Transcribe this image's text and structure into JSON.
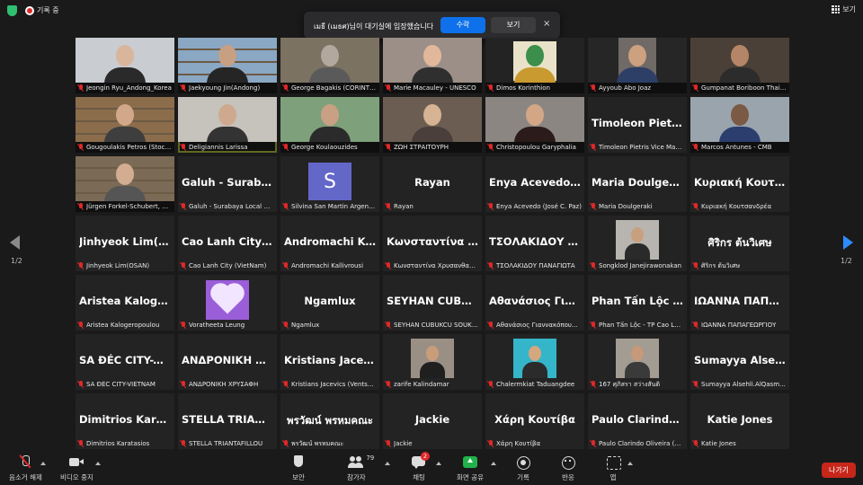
{
  "topbar": {
    "recording": "기록 중",
    "view": "보기"
  },
  "notification": {
    "message": "เมธี (เมธศ)님이 대기실에 입장했습니다",
    "admit": "수락",
    "view": "보기",
    "close": "×"
  },
  "pagination": {
    "left": "1/2",
    "right": "1/2"
  },
  "tiles": [
    {
      "name": "",
      "label": "Jeongin Ryu_Andong_Korea",
      "video": true,
      "bg": "#c9cdd2",
      "head": "#d9b59c",
      "body": "#2a2a2a"
    },
    {
      "name": "",
      "label": "Jaekyoung Jin(Andong)",
      "video": true,
      "bg": "#8aa7c3",
      "head": "#c79f82",
      "body": "#252525",
      "shelves": true
    },
    {
      "name": "",
      "label": "George Bagakis (CORINTH_GR)",
      "video": true,
      "bg": "#7c7262",
      "head": "#b2a89d",
      "body": "#5a5a5a"
    },
    {
      "name": "",
      "label": "Marie Macauley - UNESCO",
      "video": true,
      "bg": "#9b8f88",
      "head": "#e2b89c",
      "body": "#2f2f2f"
    },
    {
      "name": "",
      "label": "Dimos Korinthion",
      "video": true,
      "bg": "#232323",
      "head": "#3b8f4a",
      "body": "#c89a2f",
      "logo": true
    },
    {
      "name": "",
      "label": "Ayyoub Abo Joaz",
      "video": true,
      "bg": "#262626",
      "head": "#cda07f",
      "body": "#2d3f66",
      "small": true
    },
    {
      "name": "",
      "label": "Gumpanat Boriboon Thailand",
      "video": true,
      "bg": "#4a4038",
      "head": "#b48667",
      "body": "#2c2c2c"
    },
    {
      "name": "",
      "label": "Gougoulakis Petros (Stockholm)",
      "video": true,
      "bg": "#8b6d4c",
      "head": "#d1a88a",
      "body": "#3e3e3e",
      "shelves": true
    },
    {
      "name": "",
      "label": "Deligiannis Larissa",
      "video": true,
      "bg": "#c6c2bc",
      "head": "#cfa98f",
      "body": "#333333",
      "active": true
    },
    {
      "name": "",
      "label": "George Koulaouzides",
      "video": true,
      "bg": "#7ea07a",
      "head": "#c9a083",
      "body": "#2b2b2b"
    },
    {
      "name": "",
      "label": "ΖΩΗ ΣΤΡΑΙΤΟΥΡΗ",
      "video": true,
      "bg": "#6b5d52",
      "head": "#d6b393",
      "body": "#4a3f3a"
    },
    {
      "name": "",
      "label": "Christopoulou Garyphalia",
      "video": true,
      "bg": "#8b8682",
      "head": "#d3a686",
      "body": "#2b1b1b"
    },
    {
      "name": "Timoleon Pietri...",
      "label": "Timoleon Pietris Vice Mayor",
      "video": false
    },
    {
      "name": "",
      "label": "Marcos Antunes - CMB",
      "video": true,
      "bg": "#9aa4ad",
      "head": "#7a5a45",
      "body": "#2c3e6e"
    },
    {
      "name": "",
      "label": "Jürgen Forkel-Schubert, Hamburg",
      "video": true,
      "bg": "#7b6a55",
      "head": "#d2ad91",
      "body": "#555555",
      "shelves": true
    },
    {
      "name": "Galuh - Surabay...",
      "label": "Galuh - Surabaya Local Gover...",
      "video": false
    },
    {
      "name": "",
      "label": "Silvina San Martin Argentina",
      "video": false,
      "avatar": "S"
    },
    {
      "name": "Rayan",
      "label": "Rayan",
      "video": false
    },
    {
      "name": "Enya Acevedo (J...",
      "label": "Enya Acevedo (José C. Paz)",
      "video": false
    },
    {
      "name": "Maria Doulgeraki",
      "label": "Maria Doulgeraki",
      "video": false
    },
    {
      "name": "Κυριακή Κουτσ...",
      "label": "Κυριακή Κουτσανδρέα",
      "video": false
    },
    {
      "name": "Jinhyeok Lim(O...",
      "label": "Jinhyeok Lim(OSAN)",
      "video": false
    },
    {
      "name": "Cao Lanh City (...",
      "label": "Cao Lanh City (VietNam)",
      "video": false
    },
    {
      "name": "Andromachi Kal...",
      "label": "Andromachi Kallivrousi",
      "video": false
    },
    {
      "name": "Κωνσταντίνα Χ...",
      "label": "Κωνσταντίνα Χρυσανθακοπούλου",
      "video": false
    },
    {
      "name": "ΤΣΟΛΑΚΙΔΟΥ Π...",
      "label": "ΤΣΟΛΑΚΙΔΟΥ ΠΑΝΑΓΙΩΤΑ",
      "video": false
    },
    {
      "name": "",
      "label": "Songklod Janejirawonakan",
      "video": false,
      "photo": true,
      "photoBg": "#b8b5b0",
      "photoHead": "#c9a07e",
      "photoBody": "#2a2a2a"
    },
    {
      "name": "ศิริกร ต้นวิเศษ",
      "label": "ศิริกร ต้นวิเศษ",
      "video": false
    },
    {
      "name": "Aristea Kaloger...",
      "label": "Aristea Kalogeropoulou",
      "video": false
    },
    {
      "name": "",
      "label": "Voratheeta Leung",
      "video": false,
      "heart": true
    },
    {
      "name": "Ngamlux",
      "label": "Ngamlux",
      "video": false
    },
    {
      "name": "SEYHAN CUBUK...",
      "label": "SEYHAN CUBUKCU SOUKE...",
      "video": false
    },
    {
      "name": "Αθανάσιος Γιαν...",
      "label": "Αθανάσιος Γιαννακόπουλος",
      "video": false
    },
    {
      "name": "Phan Tấn Lộc -...",
      "label": "Phan Tấn Lộc - TP Cao Lãnh",
      "video": false
    },
    {
      "name": "ΙΩΑΝΝΑ ΠΑΠΑ...",
      "label": "ΙΩΑΝΝΑ ΠΑΠΑΓΕΩΡΓΙΟΥ",
      "video": false
    },
    {
      "name": "SA ĐÉC CITY-VI...",
      "label": "SA ĐÉC CITY-VIETNAM",
      "video": false
    },
    {
      "name": "ΑΝΔΡΟΝΙΚΗ Χ...",
      "label": "ΑΝΔΡΟΝΙΚΗ ΧΡΥΣΑΦΗ",
      "video": false
    },
    {
      "name": "Kristians Jacevic...",
      "label": "Kristians Jacevics (Ventspils)",
      "video": false
    },
    {
      "name": "",
      "label": "zarife Kalindamar",
      "video": false,
      "photo": true,
      "photoBg": "#9a8f85",
      "photoHead": "#c99c7a",
      "photoBody": "#1f1f1f"
    },
    {
      "name": "",
      "label": "Chalermkiat Taduangdee",
      "video": false,
      "photo": true,
      "photoBg": "#35b5c9",
      "photoHead": "#d4a77f",
      "photoBody": "#2b2b2b"
    },
    {
      "name": "",
      "label": "167 ศุภิสรา สว่างสันติ",
      "video": false,
      "photo": true,
      "photoBg": "#a39c92",
      "photoHead": "#c5997a",
      "photoBody": "#3a3a3a"
    },
    {
      "name": "Sumayya Alseh...",
      "label": "Sumayya Alsehli.AlQasm...",
      "video": false
    },
    {
      "name": "Dimitrios Karat...",
      "label": "Dimitrios Karatasios",
      "video": false
    },
    {
      "name": "STELLA TRIANT...",
      "label": "STELLA TRIANTAFILLOU",
      "video": false
    },
    {
      "name": "พรวัฒน์ พรหมคณะ",
      "label": "พรวัฒน์ พรหมคณะ",
      "video": false
    },
    {
      "name": "Jackie",
      "label": "Jackie",
      "video": false
    },
    {
      "name": "Χάρη Κουτίβα",
      "label": "Χάρη Κουτίβα",
      "video": false
    },
    {
      "name": "Paulo Clarindo...",
      "label": "Paulo Clarindo Oliveira (Uni...",
      "video": false
    },
    {
      "name": "Katie Jones",
      "label": "Katie Jones",
      "video": false
    }
  ],
  "toolbar": {
    "mute": "음소거 해제",
    "video": "비디오 중지",
    "security": "보안",
    "participants": "참가자",
    "participant_count": "79",
    "chat": "채팅",
    "chat_badge": "2",
    "share": "화면 공유",
    "record": "기록",
    "reactions": "반응",
    "apps": "앱",
    "leave": "나가기"
  }
}
